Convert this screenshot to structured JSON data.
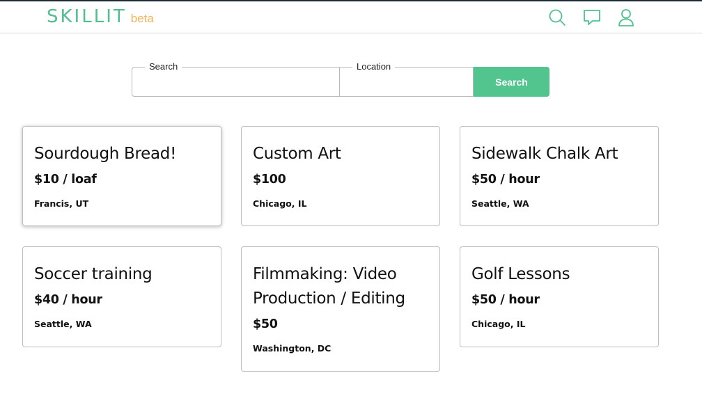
{
  "app": {
    "brand": "SKILLIT",
    "beta_tag": "beta",
    "brand_color": "#4fc08d",
    "beta_color": "#f0b35a",
    "accent": "#52c48d"
  },
  "nav": {
    "icons": [
      "search-icon",
      "chat-icon",
      "user-icon"
    ]
  },
  "search": {
    "search_label": "Search",
    "search_value": "",
    "location_label": "Location",
    "location_value": "",
    "button_label": "Search"
  },
  "listings": [
    {
      "title": "Sourdough Bread!",
      "price": "$10 / loaf",
      "location": "Francis, UT"
    },
    {
      "title": "Custom Art",
      "price": "$100",
      "location": "Chicago, IL"
    },
    {
      "title": "Sidewalk Chalk Art",
      "price": "$50 / hour",
      "location": "Seattle, WA"
    },
    {
      "title": "Soccer training",
      "price": "$40 / hour",
      "location": "Seattle, WA"
    },
    {
      "title": "Filmmaking: Video Production / Editing",
      "price": "$50",
      "location": "Washington, DC"
    },
    {
      "title": "Golf Lessons",
      "price": "$50 / hour",
      "location": "Chicago, IL"
    }
  ]
}
